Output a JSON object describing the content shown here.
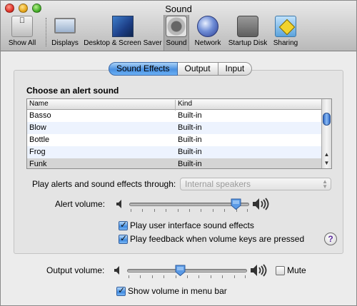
{
  "window": {
    "title": "Sound"
  },
  "toolbar": {
    "items": [
      {
        "label": "Show All",
        "icon": "apple-icon"
      },
      {
        "label": "Displays",
        "icon": "display-icon"
      },
      {
        "label": "Desktop & Screen Saver",
        "icon": "desktop-icon"
      },
      {
        "label": "Sound",
        "icon": "speaker-icon"
      },
      {
        "label": "Network",
        "icon": "globe-icon"
      },
      {
        "label": "Startup Disk",
        "icon": "disk-icon"
      },
      {
        "label": "Sharing",
        "icon": "sharing-icon"
      }
    ],
    "selected": "Sound"
  },
  "tabs": [
    {
      "label": "Sound Effects",
      "selected": true
    },
    {
      "label": "Output",
      "selected": false
    },
    {
      "label": "Input",
      "selected": false
    }
  ],
  "alert_sound": {
    "heading": "Choose an alert sound",
    "columns": [
      "Name",
      "Kind"
    ],
    "rows": [
      {
        "name": "Basso",
        "kind": "Built-in"
      },
      {
        "name": "Blow",
        "kind": "Built-in"
      },
      {
        "name": "Bottle",
        "kind": "Built-in"
      },
      {
        "name": "Frog",
        "kind": "Built-in"
      },
      {
        "name": "Funk",
        "kind": "Built-in",
        "selected": true
      }
    ]
  },
  "play_through": {
    "label": "Play alerts and sound effects through:",
    "value": "Internal speakers",
    "disabled": true
  },
  "alert_volume": {
    "label": "Alert volume:",
    "level": 0.93
  },
  "checkboxes": {
    "ui_sounds": {
      "label": "Play user interface sound effects",
      "checked": true
    },
    "feedback": {
      "label": "Play feedback when volume keys are pressed",
      "checked": true
    }
  },
  "help": {
    "label": "?"
  },
  "output_volume": {
    "label": "Output volume:",
    "level": 0.44
  },
  "mute": {
    "label": "Mute",
    "checked": false
  },
  "show_volume": {
    "label": "Show volume in menu bar",
    "checked": true
  },
  "colors": {
    "accent": "#4a90e0",
    "selection": "#d4d4d4",
    "zebra": "#edf3fe"
  }
}
